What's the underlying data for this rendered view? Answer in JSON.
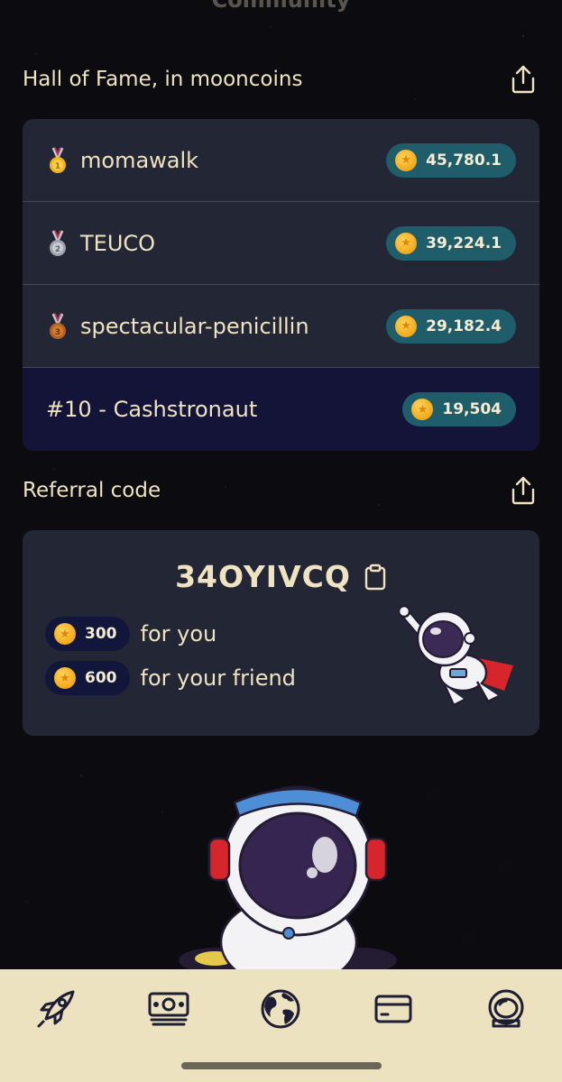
{
  "page": {
    "title": "Community"
  },
  "hall_of_fame": {
    "title": "Hall of Fame, in mooncoins",
    "rows": [
      {
        "rank_icon": "gold-medal-icon",
        "name": "momawalk",
        "coins": "45,780.1"
      },
      {
        "rank_icon": "silver-medal-icon",
        "name": "TEUCO",
        "coins": "39,224.1"
      },
      {
        "rank_icon": "bronze-medal-icon",
        "name": "spectacular-penicillin",
        "coins": "29,182.4"
      }
    ],
    "me": {
      "name": "#10 - Cashstronaut",
      "coins": "19,504"
    }
  },
  "referral": {
    "title": "Referral code",
    "code": "34OYIVCQ",
    "rewards": [
      {
        "amount": "300",
        "label": "for you"
      },
      {
        "amount": "600",
        "label": "for your friend"
      }
    ]
  },
  "nav": {
    "items": [
      {
        "icon": "rocket-icon"
      },
      {
        "icon": "money-icon"
      },
      {
        "icon": "globe-icon"
      },
      {
        "icon": "card-icon"
      },
      {
        "icon": "astronaut-helmet-icon"
      }
    ]
  },
  "colors": {
    "background": "#0b0b10",
    "card": "#232634",
    "accent_text": "#efe3c2",
    "coin_pill": "#1f5d6b",
    "me_row": "#141438",
    "navbar": "#ede2c0"
  }
}
